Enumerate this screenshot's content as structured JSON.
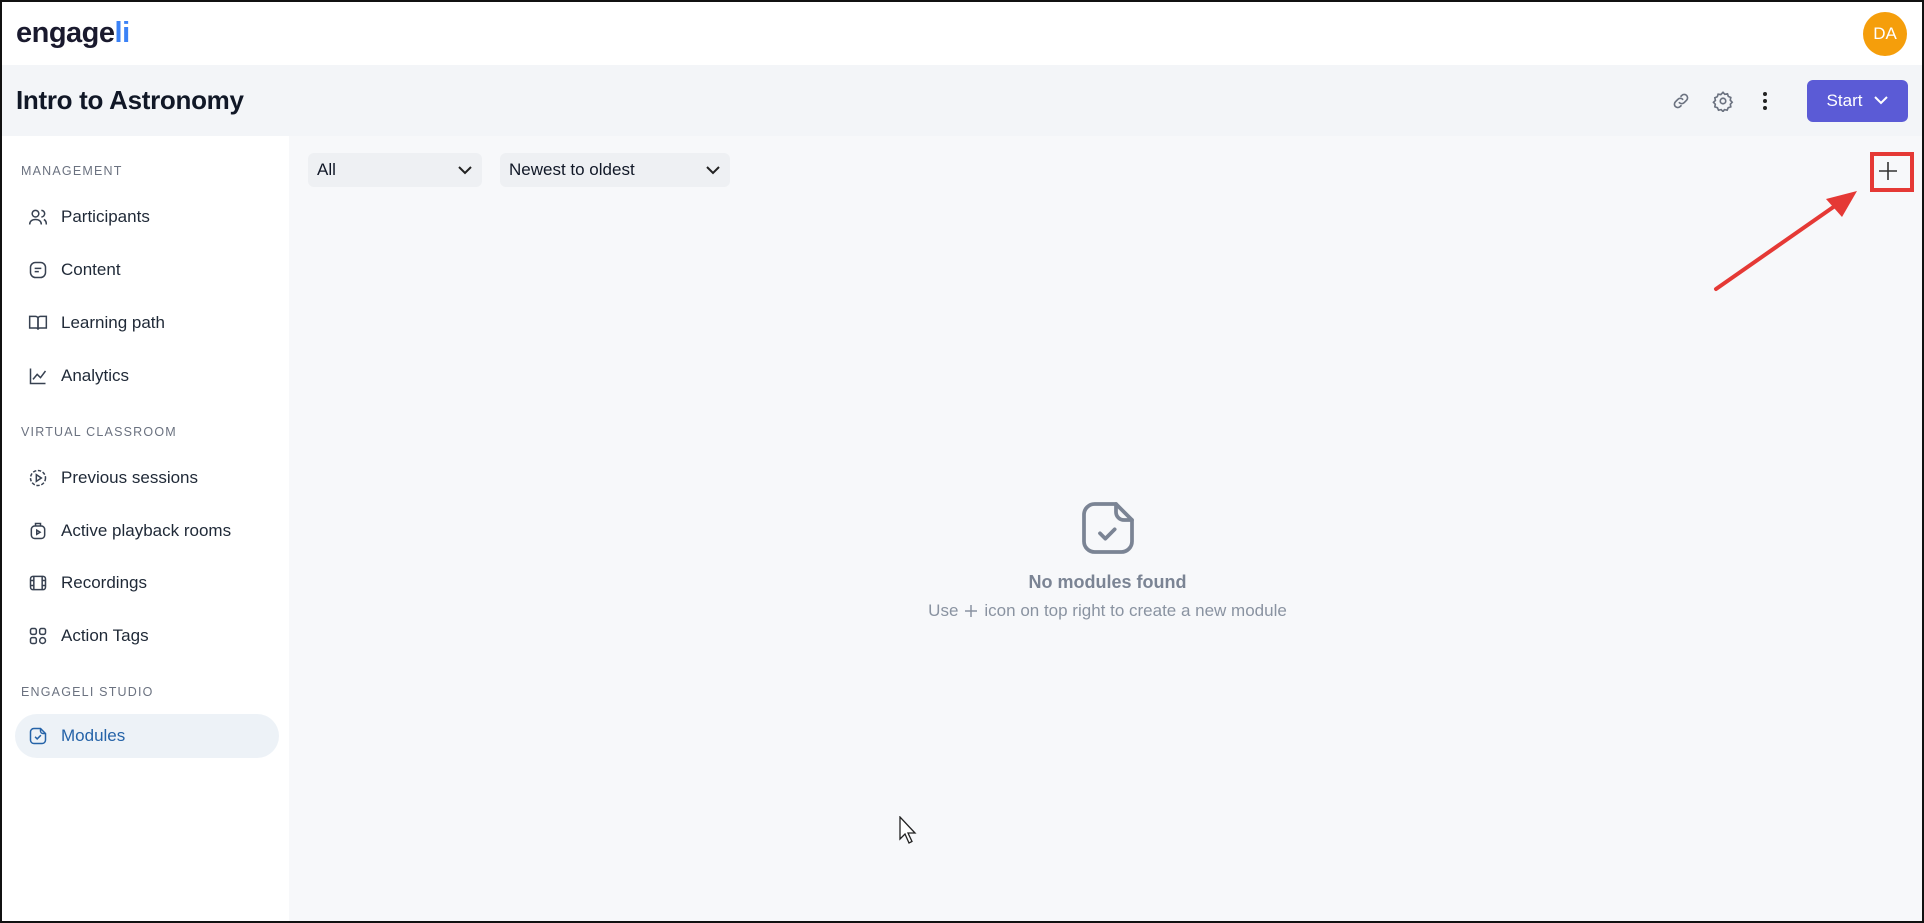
{
  "header": {
    "logo_text_main": "engage",
    "logo_text_accent": "li",
    "avatar_initials": "DA"
  },
  "titlebar": {
    "title": "Intro to Astronomy",
    "start_label": "Start"
  },
  "sidebar": {
    "sections": [
      {
        "label": "MANAGEMENT",
        "items": [
          {
            "label": "Participants",
            "icon": "users-icon"
          },
          {
            "label": "Content",
            "icon": "file-icon"
          },
          {
            "label": "Learning path",
            "icon": "book-icon"
          },
          {
            "label": "Analytics",
            "icon": "chart-line-icon"
          }
        ]
      },
      {
        "label": "VIRTUAL CLASSROOM",
        "items": [
          {
            "label": "Previous sessions",
            "icon": "play-circle-icon"
          },
          {
            "label": "Active playback rooms",
            "icon": "playback-room-icon"
          },
          {
            "label": "Recordings",
            "icon": "film-icon"
          },
          {
            "label": "Action Tags",
            "icon": "tags-icon"
          }
        ]
      },
      {
        "label": "ENGAGELI STUDIO",
        "items": [
          {
            "label": "Modules",
            "icon": "module-icon",
            "active": true
          }
        ]
      }
    ]
  },
  "filters": {
    "type_value": "All",
    "sort_value": "Newest to oldest"
  },
  "empty_state": {
    "title": "No modules found",
    "subtitle_before": "Use",
    "subtitle_after": "icon on top right to create a new module"
  },
  "colors": {
    "accent": "#5b5bd6",
    "avatar": "#f59e0b",
    "active_nav_text": "#2563a8",
    "annotation": "#e53935"
  }
}
